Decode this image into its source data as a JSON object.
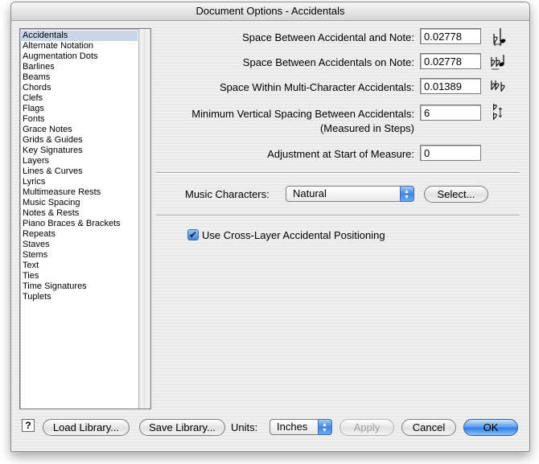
{
  "window": {
    "title": "Document Options - Accidentals"
  },
  "sidebar": {
    "items": [
      {
        "label": "Accidentals",
        "selected": true
      },
      {
        "label": "Alternate Notation"
      },
      {
        "label": "Augmentation Dots"
      },
      {
        "label": "Barlines"
      },
      {
        "label": "Beams"
      },
      {
        "label": "Chords"
      },
      {
        "label": "Clefs"
      },
      {
        "label": "Flags"
      },
      {
        "label": "Fonts"
      },
      {
        "label": "Grace Notes"
      },
      {
        "label": "Grids & Guides"
      },
      {
        "label": "Key Signatures"
      },
      {
        "label": "Layers"
      },
      {
        "label": "Lines & Curves"
      },
      {
        "label": "Lyrics"
      },
      {
        "label": "Multimeasure Rests"
      },
      {
        "label": "Music Spacing"
      },
      {
        "label": "Notes & Rests"
      },
      {
        "label": "Piano Braces & Brackets"
      },
      {
        "label": "Repeats"
      },
      {
        "label": "Staves"
      },
      {
        "label": "Stems"
      },
      {
        "label": "Text"
      },
      {
        "label": "Ties"
      },
      {
        "label": "Time Signatures"
      },
      {
        "label": "Tuplets"
      }
    ]
  },
  "settings": {
    "space_accidental_note": {
      "label": "Space Between Accidental and Note:",
      "value": "0.02778",
      "icon": "accidental-note-spacing-icon"
    },
    "space_accidentals": {
      "label": "Space Between Accidentals on Note:",
      "value": "0.02778",
      "icon": "accidentals-on-note-spacing-icon"
    },
    "space_multichar": {
      "label": "Space Within Multi-Character Accidentals:",
      "value": "0.01389",
      "icon": "multi-character-accidental-icon"
    },
    "min_vertical": {
      "label": "Minimum Vertical Spacing Between Accidentals:",
      "sublabel": "(Measured in Steps)",
      "value": "6",
      "icon": "vertical-spacing-icon"
    },
    "adjust_start": {
      "label": "Adjustment at Start of Measure:",
      "value": "0"
    }
  },
  "music_characters": {
    "label": "Music Characters:",
    "value": "Natural",
    "select_label": "Select..."
  },
  "cross_layer": {
    "label": "Use Cross-Layer Accidental Positioning",
    "checked": true
  },
  "footer": {
    "help": "?",
    "load_label": "Load Library...",
    "save_label": "Save Library...",
    "units_label": "Units:",
    "units_value": "Inches",
    "apply_label": "Apply",
    "cancel_label": "Cancel",
    "ok_label": "OK"
  },
  "colors": {
    "selection": "#c9d6ea",
    "accent": "#3f86e0"
  }
}
